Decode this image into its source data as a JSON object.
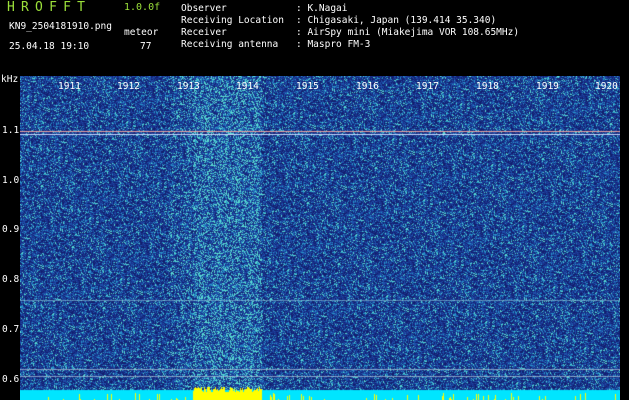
{
  "header": {
    "brand": "HROFFT",
    "version": "1.0.0f",
    "filename": "KN9_2504181910.png",
    "meteor_label": "meteor",
    "datetime": "25.04.18 19:10",
    "meteor_count": "77",
    "info": [
      {
        "key": "Observer",
        "value": ": K.Nagai"
      },
      {
        "key": "Receiving Location",
        "value": ": Chigasaki, Japan (139.414 35.340)"
      },
      {
        "key": "Receiver",
        "value": ": AirSpy mini (Miakejima VOR 108.65MHz)"
      },
      {
        "key": "Receiving antenna",
        "value": ": Maspro FM-3"
      }
    ]
  },
  "axis": {
    "unit": "kHz",
    "x_ticks": [
      "1911",
      "1912",
      "1913",
      "1914",
      "1915",
      "1916",
      "1917",
      "1918",
      "1919",
      "1920"
    ],
    "y_ticks": [
      "1.1",
      "1.0",
      "0.9",
      "0.8",
      "0.7",
      "0.6"
    ]
  },
  "colors": {
    "background": "#000000",
    "brand_text": "#9be03a",
    "label_text": "#ffffff",
    "spectrogram_base": "#1f2f8f",
    "noise_high": "#34c8c8",
    "baseline": "#00e5ff",
    "baseline_peak": "#ffff00",
    "carrier_line": "#e8a0a0"
  }
}
